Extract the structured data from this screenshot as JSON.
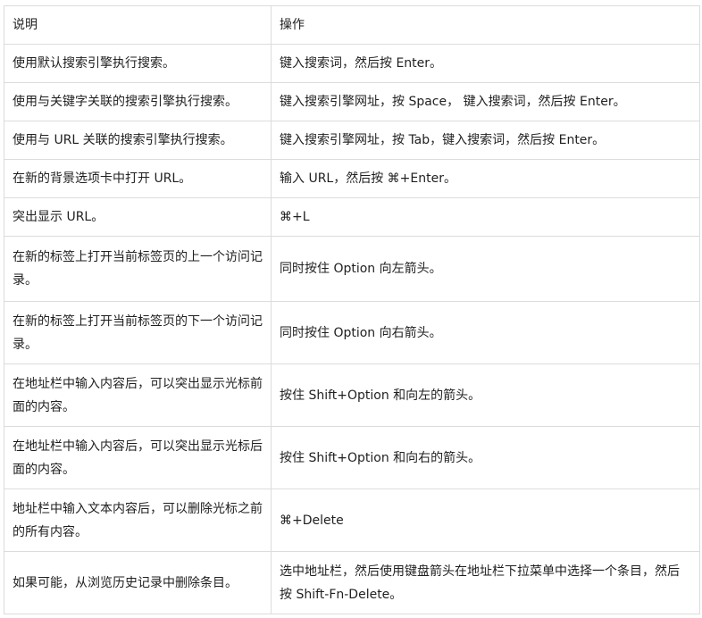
{
  "table": {
    "headers": [
      "说明",
      "操作"
    ],
    "rows": [
      [
        "使用默认搜索引擎执行搜索。",
        "键入搜索词，然后按 Enter。"
      ],
      [
        "使用与关键字关联的搜索引擎执行搜索。",
        "键入搜索引擎网址，按 Space， 键入搜索词，然后按 Enter。"
      ],
      [
        "使用与 URL 关联的搜索引擎执行搜索。",
        "键入搜索引擎网址，按 Tab，键入搜索词，然后按 Enter。"
      ],
      [
        "在新的背景选项卡中打开 URL。",
        "输入 URL，然后按 ⌘+Enter。"
      ],
      [
        "突出显示 URL。",
        "⌘+L"
      ],
      [
        "在新的标签上打开当前标签页的上一个访问记录。",
        "同时按住 Option 向左箭头。"
      ],
      [
        "在新的标签上打开当前标签页的下一个访问记录。",
        "同时按住 Option 向右箭头。"
      ],
      [
        "在地址栏中输入内容后，可以突出显示光标前面的内容。",
        "按住 Shift+Option 和向左的箭头。"
      ],
      [
        "在地址栏中输入内容后，可以突出显示光标后面的内容。",
        "按住 Shift+Option 和向右的箭头。"
      ],
      [
        "地址栏中输入文本内容后，可以删除光标之前的所有内容。",
        "⌘+Delete"
      ],
      [
        "如果可能，从浏览历史记录中删除条目。",
        "选中地址栏，然后使用键盘箭头在地址栏下拉菜单中选择一个条目，然后按 Shift-Fn-Delete。"
      ]
    ]
  }
}
